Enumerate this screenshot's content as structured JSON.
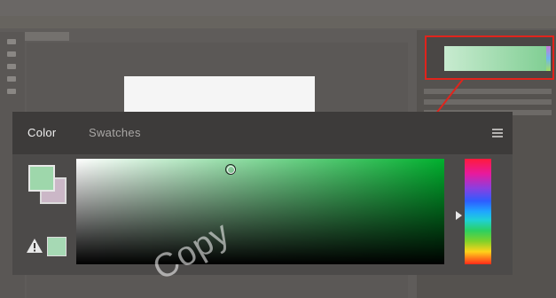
{
  "panel": {
    "tabs": [
      {
        "label": "Color",
        "active": true
      },
      {
        "label": "Swatches",
        "active": false
      }
    ]
  },
  "colors": {
    "foreground": "#9ed7ab",
    "background": "#cbb7c7",
    "gamut_warning_swatch": "#a6d9b4",
    "picker_hue": "#00b02e",
    "callout_border": "#e0241c"
  },
  "icons": {
    "menu": "panel-menu-icon",
    "warning": "gamut-warning-icon",
    "picker": "color-picker-cursor-icon",
    "hue_marker": "hue-slider-marker-icon"
  },
  "watermark": {
    "text": "Copy"
  }
}
